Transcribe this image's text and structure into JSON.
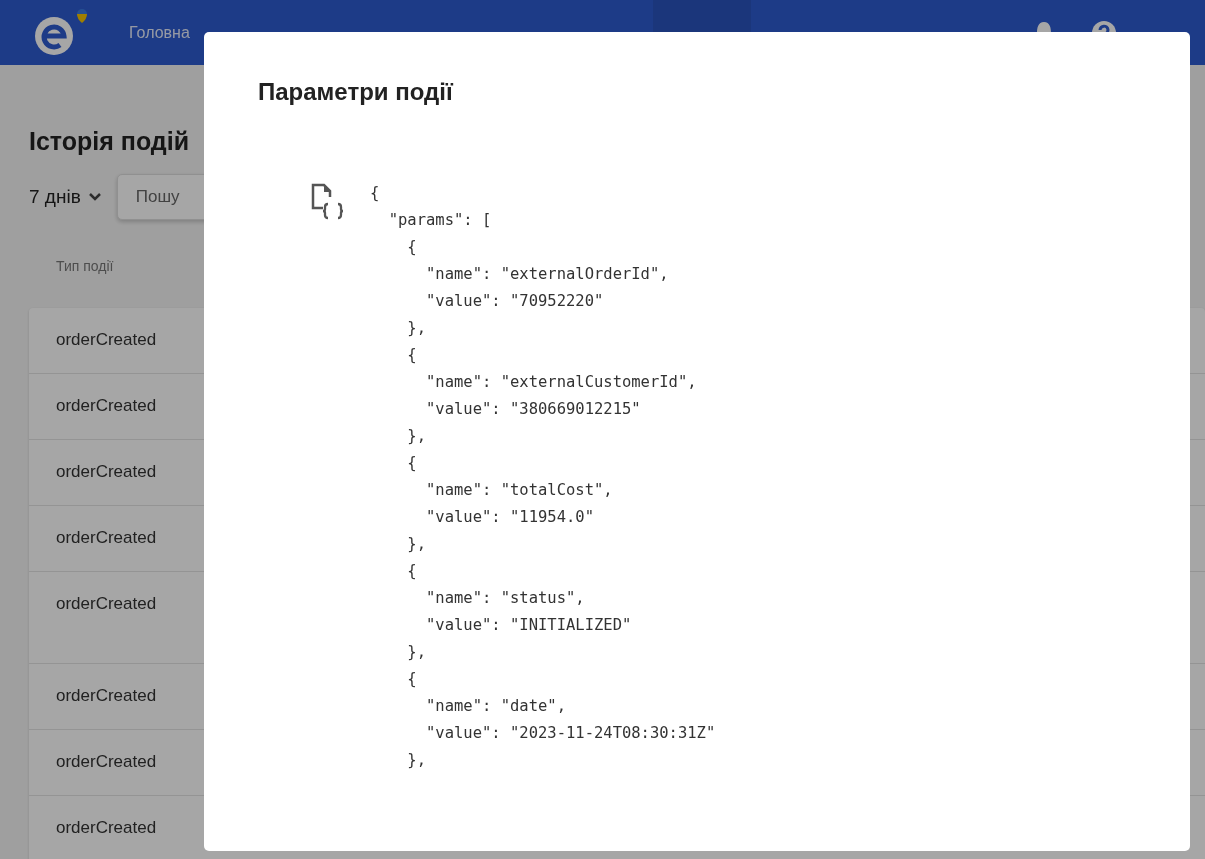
{
  "nav": {
    "items": [
      {
        "label": "Головна",
        "selected": false
      },
      {
        "selected": false
      },
      {
        "selected": false
      },
      {
        "selected": false
      },
      {
        "selected": false
      },
      {
        "selected": true
      }
    ]
  },
  "page": {
    "title": "Історія подій",
    "period": "7 днів",
    "search": {
      "placeholder": "Пошу"
    },
    "table": {
      "columns": [
        "Тип події"
      ],
      "rows": [
        {
          "event_type": "orderCreated"
        },
        {
          "event_type": "orderCreated"
        },
        {
          "event_type": "orderCreated"
        },
        {
          "event_type": "orderCreated"
        },
        {
          "event_type": "orderCreated"
        },
        {
          "event_type": "orderCreated"
        },
        {
          "event_type": "orderCreated"
        },
        {
          "event_type": "orderCreated"
        }
      ]
    }
  },
  "modal": {
    "title": "Параметри події",
    "code_lines": [
      "{",
      "  \"params\": [",
      "    {",
      "      \"name\": \"externalOrderId\",",
      "      \"value\": \"70952220\"",
      "    },",
      "    {",
      "      \"name\": \"externalCustomerId\",",
      "      \"value\": \"380669012215\"",
      "    },",
      "    {",
      "      \"name\": \"totalCost\",",
      "      \"value\": \"11954.0\"",
      "    },",
      "    {",
      "      \"name\": \"status\",",
      "      \"value\": \"INITIALIZED\"",
      "    },",
      "    {",
      "      \"name\": \"date\",",
      "      \"value\": \"2023-11-24T08:30:31Z\"",
      "    },"
    ]
  }
}
